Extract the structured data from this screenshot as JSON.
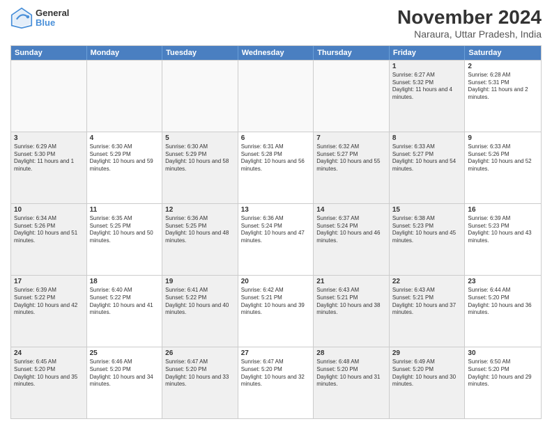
{
  "logo": {
    "line1": "General",
    "line2": "Blue"
  },
  "title": "November 2024",
  "subtitle": "Naraura, Uttar Pradesh, India",
  "header_days": [
    "Sunday",
    "Monday",
    "Tuesday",
    "Wednesday",
    "Thursday",
    "Friday",
    "Saturday"
  ],
  "rows": [
    [
      {
        "day": "",
        "text": "",
        "empty": true
      },
      {
        "day": "",
        "text": "",
        "empty": true
      },
      {
        "day": "",
        "text": "",
        "empty": true
      },
      {
        "day": "",
        "text": "",
        "empty": true
      },
      {
        "day": "",
        "text": "",
        "empty": true
      },
      {
        "day": "1",
        "text": "Sunrise: 6:27 AM\nSunset: 5:32 PM\nDaylight: 11 hours and 4 minutes.",
        "empty": false,
        "shaded": true
      },
      {
        "day": "2",
        "text": "Sunrise: 6:28 AM\nSunset: 5:31 PM\nDaylight: 11 hours and 2 minutes.",
        "empty": false
      }
    ],
    [
      {
        "day": "3",
        "text": "Sunrise: 6:29 AM\nSunset: 5:30 PM\nDaylight: 11 hours and 1 minute.",
        "empty": false,
        "shaded": true
      },
      {
        "day": "4",
        "text": "Sunrise: 6:30 AM\nSunset: 5:29 PM\nDaylight: 10 hours and 59 minutes.",
        "empty": false
      },
      {
        "day": "5",
        "text": "Sunrise: 6:30 AM\nSunset: 5:29 PM\nDaylight: 10 hours and 58 minutes.",
        "empty": false,
        "shaded": true
      },
      {
        "day": "6",
        "text": "Sunrise: 6:31 AM\nSunset: 5:28 PM\nDaylight: 10 hours and 56 minutes.",
        "empty": false
      },
      {
        "day": "7",
        "text": "Sunrise: 6:32 AM\nSunset: 5:27 PM\nDaylight: 10 hours and 55 minutes.",
        "empty": false,
        "shaded": true
      },
      {
        "day": "8",
        "text": "Sunrise: 6:33 AM\nSunset: 5:27 PM\nDaylight: 10 hours and 54 minutes.",
        "empty": false,
        "shaded": true
      },
      {
        "day": "9",
        "text": "Sunrise: 6:33 AM\nSunset: 5:26 PM\nDaylight: 10 hours and 52 minutes.",
        "empty": false
      }
    ],
    [
      {
        "day": "10",
        "text": "Sunrise: 6:34 AM\nSunset: 5:26 PM\nDaylight: 10 hours and 51 minutes.",
        "empty": false,
        "shaded": true
      },
      {
        "day": "11",
        "text": "Sunrise: 6:35 AM\nSunset: 5:25 PM\nDaylight: 10 hours and 50 minutes.",
        "empty": false
      },
      {
        "day": "12",
        "text": "Sunrise: 6:36 AM\nSunset: 5:25 PM\nDaylight: 10 hours and 48 minutes.",
        "empty": false,
        "shaded": true
      },
      {
        "day": "13",
        "text": "Sunrise: 6:36 AM\nSunset: 5:24 PM\nDaylight: 10 hours and 47 minutes.",
        "empty": false
      },
      {
        "day": "14",
        "text": "Sunrise: 6:37 AM\nSunset: 5:24 PM\nDaylight: 10 hours and 46 minutes.",
        "empty": false,
        "shaded": true
      },
      {
        "day": "15",
        "text": "Sunrise: 6:38 AM\nSunset: 5:23 PM\nDaylight: 10 hours and 45 minutes.",
        "empty": false,
        "shaded": true
      },
      {
        "day": "16",
        "text": "Sunrise: 6:39 AM\nSunset: 5:23 PM\nDaylight: 10 hours and 43 minutes.",
        "empty": false
      }
    ],
    [
      {
        "day": "17",
        "text": "Sunrise: 6:39 AM\nSunset: 5:22 PM\nDaylight: 10 hours and 42 minutes.",
        "empty": false,
        "shaded": true
      },
      {
        "day": "18",
        "text": "Sunrise: 6:40 AM\nSunset: 5:22 PM\nDaylight: 10 hours and 41 minutes.",
        "empty": false
      },
      {
        "day": "19",
        "text": "Sunrise: 6:41 AM\nSunset: 5:22 PM\nDaylight: 10 hours and 40 minutes.",
        "empty": false,
        "shaded": true
      },
      {
        "day": "20",
        "text": "Sunrise: 6:42 AM\nSunset: 5:21 PM\nDaylight: 10 hours and 39 minutes.",
        "empty": false
      },
      {
        "day": "21",
        "text": "Sunrise: 6:43 AM\nSunset: 5:21 PM\nDaylight: 10 hours and 38 minutes.",
        "empty": false,
        "shaded": true
      },
      {
        "day": "22",
        "text": "Sunrise: 6:43 AM\nSunset: 5:21 PM\nDaylight: 10 hours and 37 minutes.",
        "empty": false,
        "shaded": true
      },
      {
        "day": "23",
        "text": "Sunrise: 6:44 AM\nSunset: 5:20 PM\nDaylight: 10 hours and 36 minutes.",
        "empty": false
      }
    ],
    [
      {
        "day": "24",
        "text": "Sunrise: 6:45 AM\nSunset: 5:20 PM\nDaylight: 10 hours and 35 minutes.",
        "empty": false,
        "shaded": true
      },
      {
        "day": "25",
        "text": "Sunrise: 6:46 AM\nSunset: 5:20 PM\nDaylight: 10 hours and 34 minutes.",
        "empty": false
      },
      {
        "day": "26",
        "text": "Sunrise: 6:47 AM\nSunset: 5:20 PM\nDaylight: 10 hours and 33 minutes.",
        "empty": false,
        "shaded": true
      },
      {
        "day": "27",
        "text": "Sunrise: 6:47 AM\nSunset: 5:20 PM\nDaylight: 10 hours and 32 minutes.",
        "empty": false
      },
      {
        "day": "28",
        "text": "Sunrise: 6:48 AM\nSunset: 5:20 PM\nDaylight: 10 hours and 31 minutes.",
        "empty": false,
        "shaded": true
      },
      {
        "day": "29",
        "text": "Sunrise: 6:49 AM\nSunset: 5:20 PM\nDaylight: 10 hours and 30 minutes.",
        "empty": false,
        "shaded": true
      },
      {
        "day": "30",
        "text": "Sunrise: 6:50 AM\nSunset: 5:20 PM\nDaylight: 10 hours and 29 minutes.",
        "empty": false
      }
    ]
  ]
}
